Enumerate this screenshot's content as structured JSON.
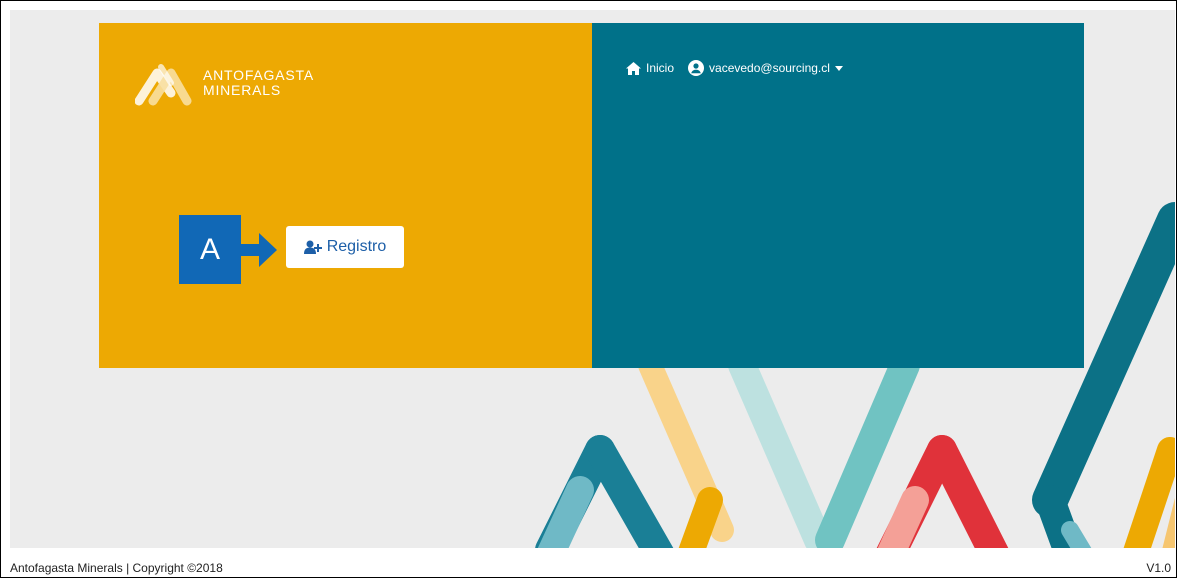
{
  "brand": {
    "line1": "ANTOFAGASTA",
    "line2": "MINERALS"
  },
  "callout": {
    "label": "A"
  },
  "actions": {
    "register_label": "Registro"
  },
  "nav": {
    "home_label": "Inicio",
    "user_email": "vacevedo@sourcing.cl"
  },
  "footer": {
    "copyright": "Antofagasta Minerals | Copyright ©2018",
    "version": "V1.0"
  },
  "icons": {
    "logo": "antofagasta-logo-icon",
    "home": "home-icon",
    "user": "user-circle-icon",
    "caret": "caret-down-icon",
    "register": "user-plus-icon",
    "callout_arrow": "arrow-right-icon"
  },
  "colors": {
    "brand_orange": "#eda903",
    "nav_teal": "#007189",
    "callout_blue": "#1168b6",
    "background": "#ececec"
  }
}
